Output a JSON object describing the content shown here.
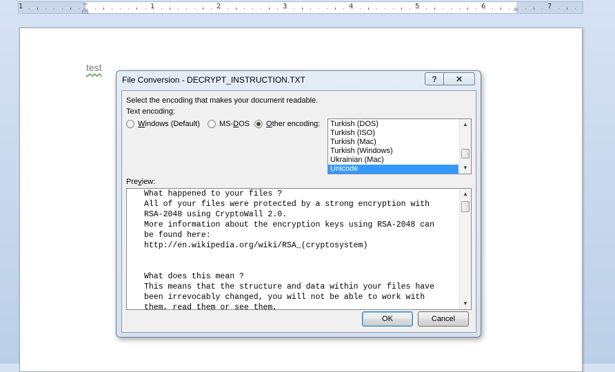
{
  "ruler": {
    "numbers": [
      "1",
      "1",
      "2",
      "3",
      "4",
      "5",
      "6",
      "7"
    ]
  },
  "document": {
    "text": "test"
  },
  "dialog": {
    "title": "File Conversion - DECRYPT_INSTRUCTION.TXT",
    "help_button": "?",
    "close_button": "✕",
    "instruction": "Select the encoding that makes your document readable.",
    "text_encoding_label": "Text encoding:",
    "radio_windows_underlined": "W",
    "radio_windows_rest": "indows (Default)",
    "radio_msdos_prefix": "MS-",
    "radio_msdos_underlined": "D",
    "radio_msdos_rest": "OS",
    "radio_other_underlined": "O",
    "radio_other_rest": "ther encoding:",
    "selected_radio": "Other encoding:",
    "encodings": [
      "Turkish (DOS)",
      "Turkish (ISO)",
      "Turkish (Mac)",
      "Turkish (Windows)",
      "Ukrainian (Mac)",
      "Unicode"
    ],
    "selected_encoding": "Unicode",
    "preview_label_prefix": "Pre",
    "preview_label_underlined": "v",
    "preview_label_rest": "iew:",
    "preview_lines": [
      "What happened to your files ?",
      "All of your files were protected by a strong encryption with",
      "RSA-2048 using CryptoWall 2.0.",
      "More information about the encryption keys using RSA-2048 can",
      "be found here:",
      "http://en.wikipedia.org/wiki/RSA_(cryptosystem)",
      "",
      "",
      "What does this mean ?",
      "This means that the structure and data within your files have",
      "been irrevocably changed, you will not be able to work with",
      "them, read them or see them,"
    ],
    "ok_button": "OK",
    "cancel_button": "Cancel"
  },
  "icons": {
    "scroll_up": "scroll-up-arrow-icon",
    "scroll_down": "scroll-down-arrow-icon"
  }
}
